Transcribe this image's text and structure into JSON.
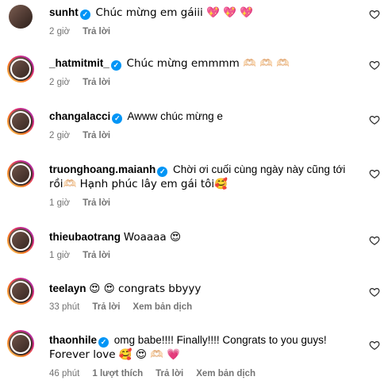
{
  "comments": [
    {
      "user": "sunht",
      "text": "Chúc mừng em gáiii 💖 💖 💖",
      "time": "2 giờ",
      "reply": "Trả lời"
    },
    {
      "user": "_hatmitmit_",
      "text": "Chúc mừng emmmm 🫶🏻 🫶🏻 🫶🏻",
      "time": "2 giờ",
      "reply": "Trả lời"
    },
    {
      "user": "changalacci",
      "text": "Awww chúc mừng e",
      "time": "2 giờ",
      "reply": "Trả lời"
    },
    {
      "user": "truonghoang.maianh",
      "text_line1": "Chời ơi cuối cùng ngày này cũng tới",
      "text_line2": "rồi🫶🏻  Hạnh phúc lây em gái tôi🥰",
      "time": "1 giờ",
      "reply": "Trả lời"
    },
    {
      "user": "thieubaotrang",
      "text": "Woaaaa 😍",
      "time": "1 giờ",
      "reply": "Trả lời"
    },
    {
      "user": "teelayn",
      "text": "😍 😍 congrats bbyyy",
      "time": "33 phút",
      "reply": "Trả lời",
      "translate": "Xem bản dịch"
    },
    {
      "user": "thaonhile",
      "text_line1": "omg babe!!!! Finally!!!! Congrats to you guys!",
      "text_line2": "Forever love 🥰 😍 🫶🏻 💗",
      "time": "46 phút",
      "likes": "1 lượt thích",
      "reply": "Trả lời",
      "translate": "Xem bản dịch"
    }
  ],
  "icons": {
    "verified": "verified-badge-icon",
    "like": "heart-outline-icon"
  },
  "colors": {
    "verified": "#0095f6",
    "meta": "#737373"
  }
}
